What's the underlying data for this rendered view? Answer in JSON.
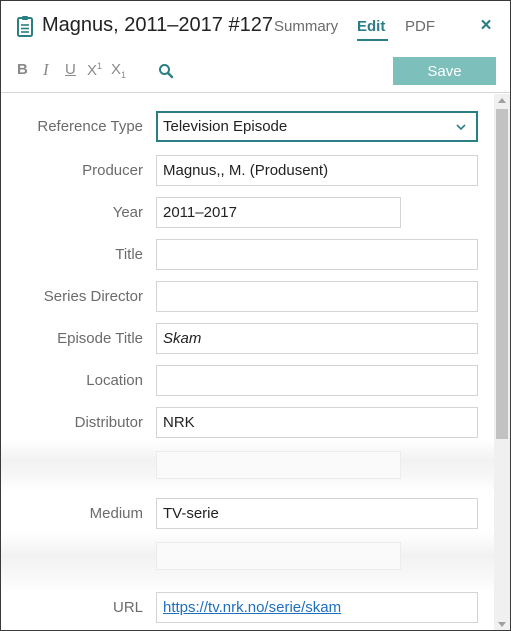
{
  "header": {
    "title": "Magnus, 2011–2017 #127",
    "tabs": {
      "summary": "Summary",
      "edit": "Edit",
      "pdf": "PDF"
    },
    "close_icon": "×",
    "accent_color": "#2a7f84"
  },
  "toolbar": {
    "bold": "B",
    "italic": "I",
    "underline": "U",
    "superscript": "X",
    "superscript_mark": "1",
    "subscript": "X",
    "subscript_mark": "1",
    "search_icon": "search-icon",
    "save_label": "Save",
    "save_color": "#7cbfbb"
  },
  "form": {
    "reference_type": {
      "label": "Reference Type",
      "value": "Television Episode"
    },
    "producer": {
      "label": "Producer",
      "value": "Magnus,, M. (Produsent)"
    },
    "year": {
      "label": "Year",
      "value": "2011–2017"
    },
    "title": {
      "label": "Title",
      "value": ""
    },
    "series_director": {
      "label": "Series Director",
      "value": ""
    },
    "episode_title": {
      "label": "Episode Title",
      "value": "Skam"
    },
    "location": {
      "label": "Location",
      "value": ""
    },
    "distributor": {
      "label": "Distributor",
      "value": "NRK"
    },
    "medium": {
      "label": "Medium",
      "value": "TV-serie"
    },
    "url": {
      "label": "URL",
      "value": "https://tv.nrk.no/serie/skam"
    }
  }
}
